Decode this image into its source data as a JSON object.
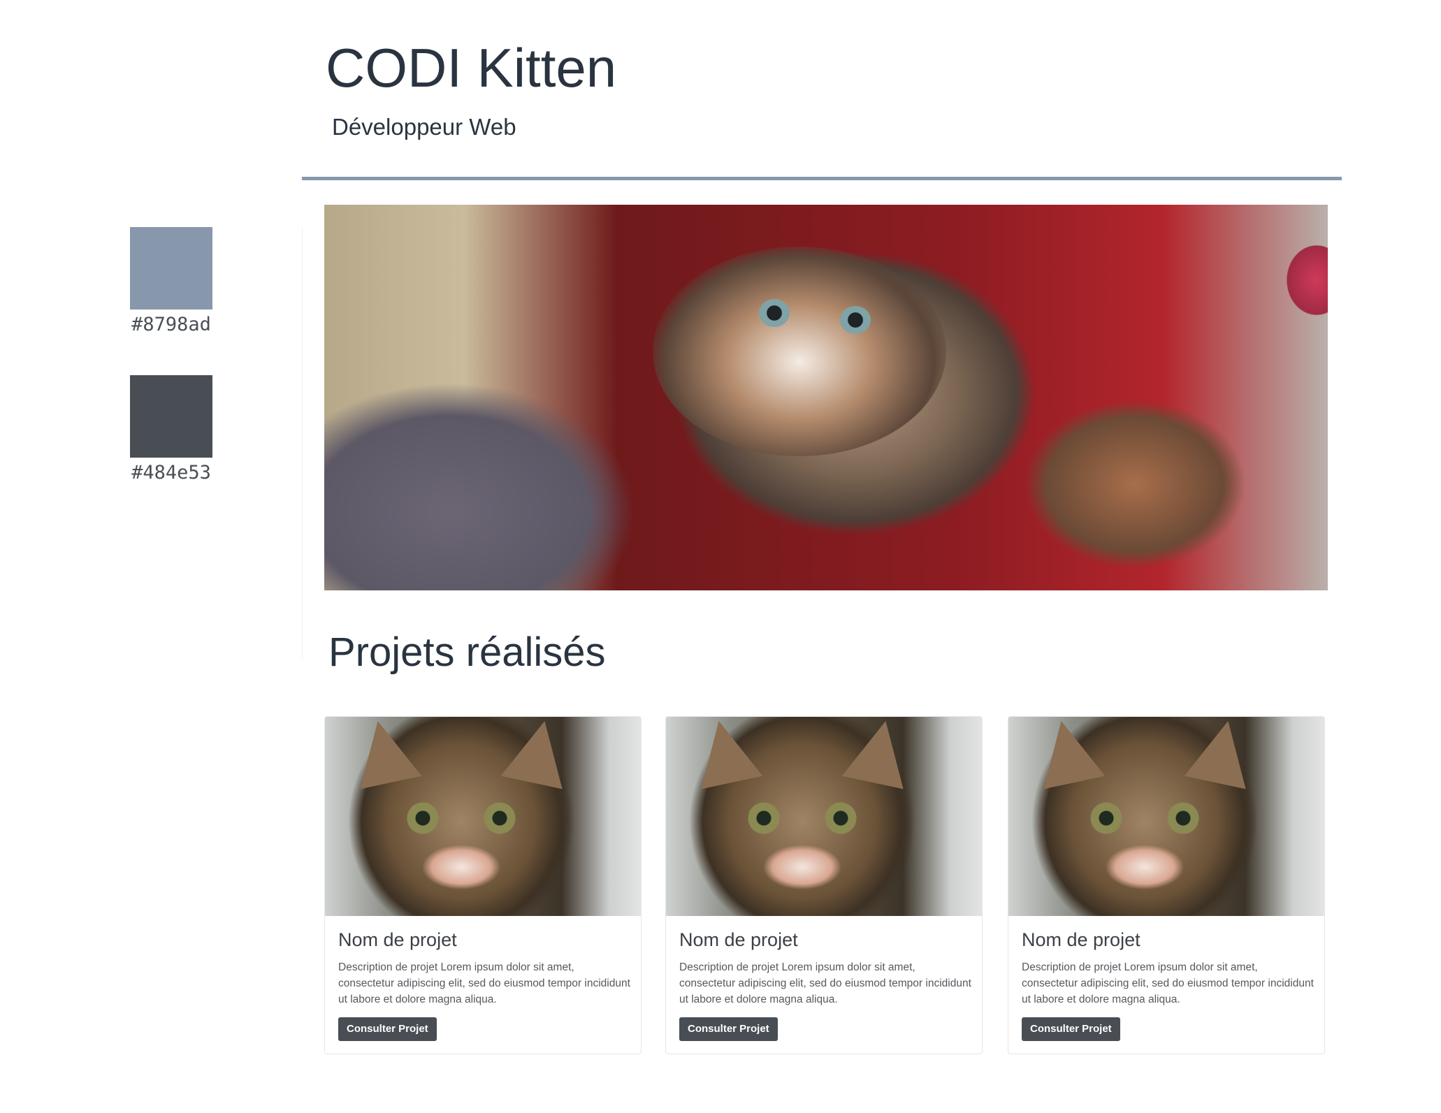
{
  "header": {
    "title": "CODI Kitten",
    "subtitle": "Développeur Web"
  },
  "palette": [
    {
      "label": "#8798ad",
      "color": "#8798ad"
    },
    {
      "label": "#484e53",
      "color": "#484e53"
    }
  ],
  "colors": {
    "rule": "#8798ad",
    "button": "#484e53"
  },
  "hero": {
    "image": "calico-kitten-photo"
  },
  "projects": {
    "title": "Projets réalisés",
    "cards": [
      {
        "image": "tabby-kitten-photo",
        "title": "Nom de projet",
        "description": "Description de projet Lorem ipsum dolor sit amet, consectetur adipiscing elit, sed do eiusmod tempor incididunt ut labore et dolore magna aliqua.",
        "button": "Consulter Projet"
      },
      {
        "image": "tabby-kitten-photo",
        "title": "Nom de projet",
        "description": "Description de projet Lorem ipsum dolor sit amet, consectetur adipiscing elit, sed do eiusmod tempor incididunt ut labore et dolore magna aliqua.",
        "button": "Consulter Projet"
      },
      {
        "image": "tabby-kitten-photo",
        "title": "Nom de projet",
        "description": "Description de projet Lorem ipsum dolor sit amet, consectetur adipiscing elit, sed do eiusmod tempor incididunt ut labore et dolore magna aliqua.",
        "button": "Consulter Projet"
      }
    ]
  }
}
